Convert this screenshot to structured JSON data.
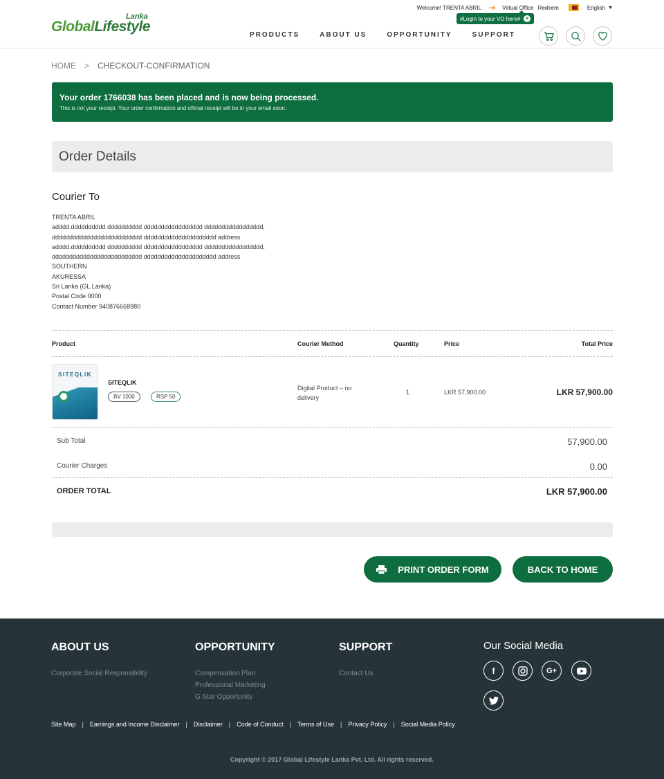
{
  "header": {
    "logo_main_1": "Global",
    "logo_main_2": "Lifestyle",
    "logo_sub": "Lanka",
    "welcome": "Welcome! TRENTA ABRIL",
    "virtual_office": "Virtual Office",
    "redeem": "Redeem",
    "language": "English",
    "tooltip": "#Login to your VO here#",
    "nav": [
      "PRODUCTS",
      "ABOUT US",
      "OPPORTUNITY",
      "SUPPORT"
    ],
    "icons": [
      "cart-icon",
      "search-icon",
      "heart-icon"
    ]
  },
  "breadcrumb": {
    "home": "HOME",
    "separator": ">",
    "current": "CHECKOUT-CONFIRMATION"
  },
  "alert": {
    "title": "Your order 1766038 has been placed and is now being processed.",
    "subtitle": "This is not your receipt. Your order confirmation and official receipt will be in your email soon."
  },
  "order_details": {
    "heading": "Order Details",
    "courier_heading": "Courier To",
    "address_lines": [
      "TRENTA ABRIL",
      "adddd.dddddddddd dddddddddd ddddddddddddddddd ddddddddddddddddd,",
      "dddddddddddddddddddddddddd ddddddddddddddddddddd address",
      "adddd.dddddddddd dddddddddd ddddddddddddddddd ddddddddddddddddd,",
      "dddddddddddddddddddddddddd ddddddddddddddddddddd address",
      "SOUTHERN",
      "AKURESSA",
      "Sri Lanka (GL Lanka)",
      "Postal Code 0000",
      "Contact Number 940876668980"
    ]
  },
  "table": {
    "headers": {
      "product": "Product",
      "courier_method": "Courier Method",
      "quantity": "Quantity",
      "price": "Price",
      "total_price": "Total Price"
    },
    "items": [
      {
        "image_text": "SITEQLIK",
        "name": "SITEQLIK",
        "bv": "BV 1000",
        "rsp": "RSP 50",
        "courier_method": "Digital Product – no delivery",
        "quantity": "1",
        "price": "LKR 57,900.00",
        "total": "LKR 57,900.00"
      }
    ]
  },
  "summary": {
    "subtotal_label": "Sub Total",
    "subtotal_value": "57,900.00",
    "courier_label": "Courier Charges",
    "courier_value": "0.00",
    "total_label": "ORDER TOTAL",
    "total_value": "LKR 57,900.00"
  },
  "buttons": {
    "print": "PRINT ORDER FORM",
    "home": "BACK TO HOME"
  },
  "footer": {
    "about_title": "ABOUT US",
    "about_links": [
      "Corporate Social Responsibility"
    ],
    "opportunity_title": "OPPORTUNITY",
    "opportunity_links": [
      "Compensation Plan",
      "Professional Marketing",
      "G Star Opportunity"
    ],
    "support_title": "SUPPORT",
    "support_links": [
      "Contact Us"
    ],
    "social_title": "Our Social Media",
    "social_icons": [
      "facebook-icon",
      "instagram-icon",
      "google-plus-icon",
      "youtube-icon",
      "twitter-icon"
    ],
    "bottom_links": [
      "Site Map",
      "Earnings and Income Disclaimer",
      "Disclaimer",
      "Code of Conduct",
      "Terms of Use",
      "Privacy Policy",
      "Social Media Policy"
    ],
    "copyright": "Copyright © 2017 Global Lifestyle Lanka Pvt. Ltd. All rights reserved."
  },
  "colors": {
    "brand_green": "#0e6d3e",
    "footer_bg": "#263439",
    "logo_green": "#4f9a3c"
  }
}
